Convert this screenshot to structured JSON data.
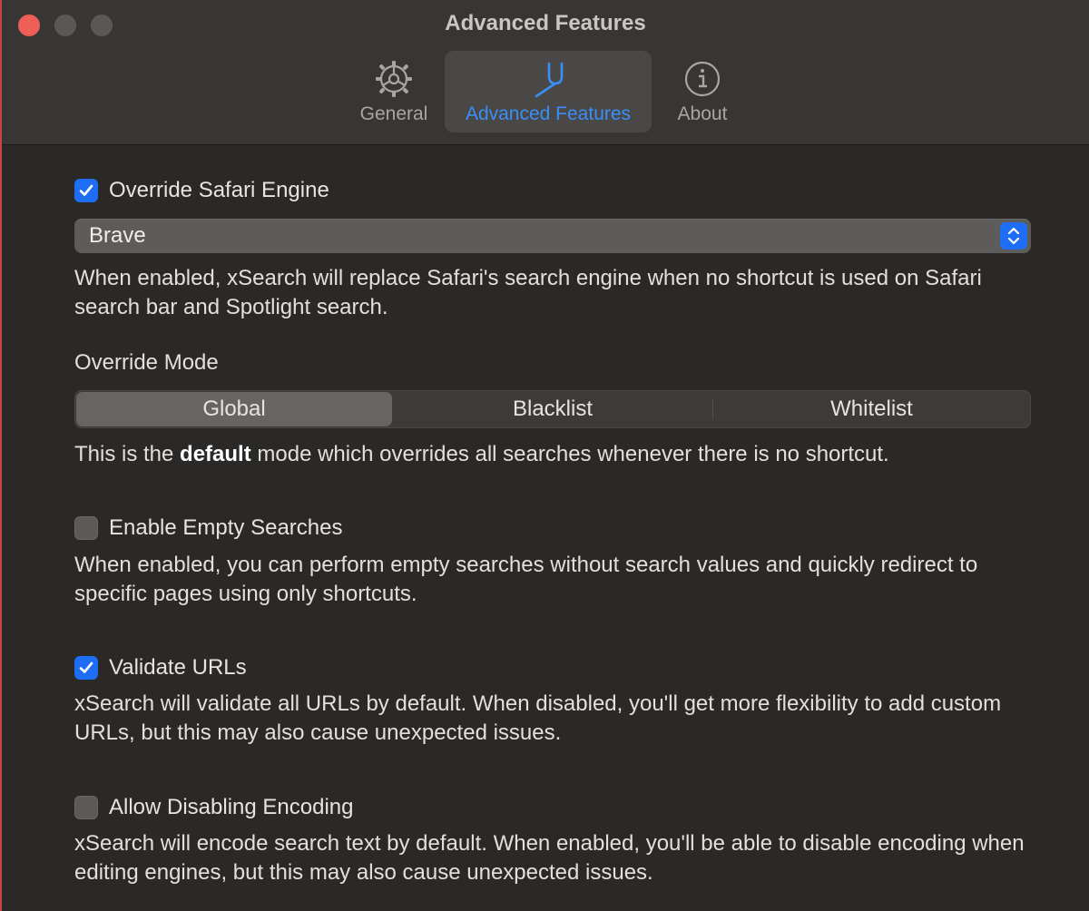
{
  "window": {
    "title": "Advanced Features",
    "accent_color": "#1d6ef5"
  },
  "toolbar": {
    "tabs": [
      {
        "label": "General",
        "icon": "gear-icon",
        "selected": false
      },
      {
        "label": "Advanced Features",
        "icon": "tuning-fork-icon",
        "selected": true
      },
      {
        "label": "About",
        "icon": "info-icon",
        "selected": false
      }
    ]
  },
  "override_engine": {
    "label": "Override Safari Engine",
    "checked": true,
    "selected_engine": "Brave",
    "description": "When enabled, xSearch will replace Safari's search engine when no shortcut is used on Safari search bar and Spotlight search."
  },
  "override_mode": {
    "label": "Override Mode",
    "options": [
      "Global",
      "Blacklist",
      "Whitelist"
    ],
    "selected": "Global",
    "description_prefix": "This is the ",
    "description_bold": "default",
    "description_suffix": " mode which overrides all searches whenever there is no shortcut."
  },
  "empty_searches": {
    "label": "Enable Empty Searches",
    "checked": false,
    "description": "When enabled, you can perform empty searches without search values and quickly redirect to specific pages using only shortcuts."
  },
  "validate_urls": {
    "label": "Validate URLs",
    "checked": true,
    "description": "xSearch will validate all URLs by default. When disabled, you'll get more flexibility to add custom URLs, but this may also cause unexpected issues."
  },
  "disable_encoding": {
    "label": "Allow Disabling Encoding",
    "checked": false,
    "description": "xSearch will encode search text by default. When enabled, you'll be able to disable encoding when editing engines, but this may also cause unexpected issues."
  }
}
